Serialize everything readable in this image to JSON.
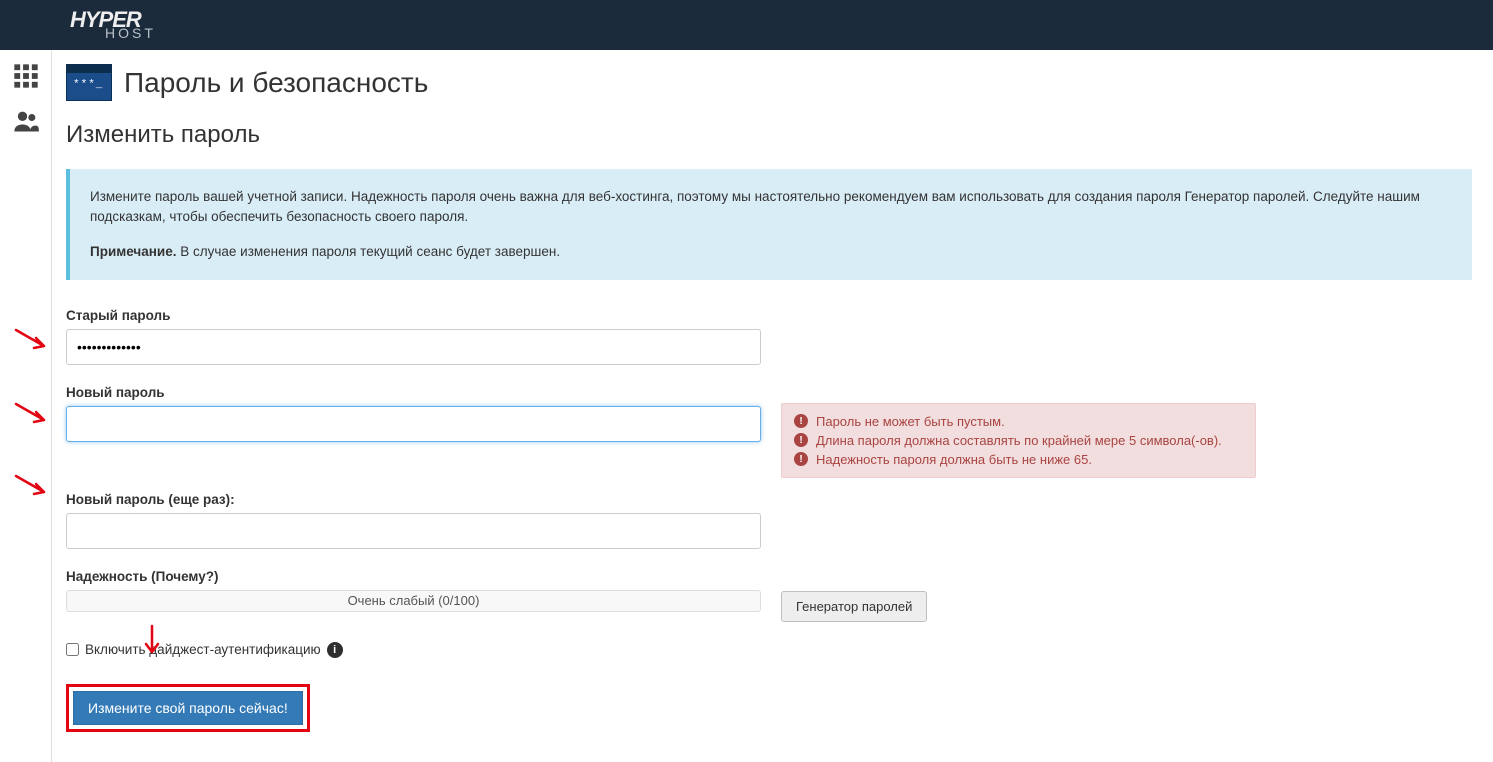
{
  "header": {
    "logo_line1": "HYPER",
    "logo_line2": "HOST"
  },
  "page": {
    "title": "Пароль и безопасность",
    "section_title": "Изменить пароль"
  },
  "info": {
    "text": "Измените пароль вашей учетной записи. Надежность пароля очень важна для веб-хостинга, поэтому мы настоятельно рекомендуем вам использовать для создания пароля Генератор паролей. Следуйте нашим подсказкам, чтобы обеспечить безопасность своего пароля.",
    "note_label": "Примечание.",
    "note_text": " В случае изменения пароля текущий сеанс будет завершен."
  },
  "form": {
    "old_password": {
      "label": "Старый пароль",
      "value": "•••••••••••••"
    },
    "new_password": {
      "label": "Новый пароль",
      "value": ""
    },
    "confirm_password": {
      "label": "Новый пароль (еще раз):",
      "value": ""
    },
    "strength": {
      "label": "Надежность (Почему?)",
      "meter_text": "Очень слабый (0/100)"
    },
    "generator_button": "Генератор паролей",
    "digest_checkbox": "Включить дайджест-аутентификацию",
    "submit_button": "Измените свой пароль сейчас!"
  },
  "errors": {
    "items": [
      "Пароль не может быть пустым.",
      "Длина пароля должна составлять по крайней мере 5 символа(-ов).",
      "Надежность пароля должна быть не ниже 65."
    ]
  }
}
